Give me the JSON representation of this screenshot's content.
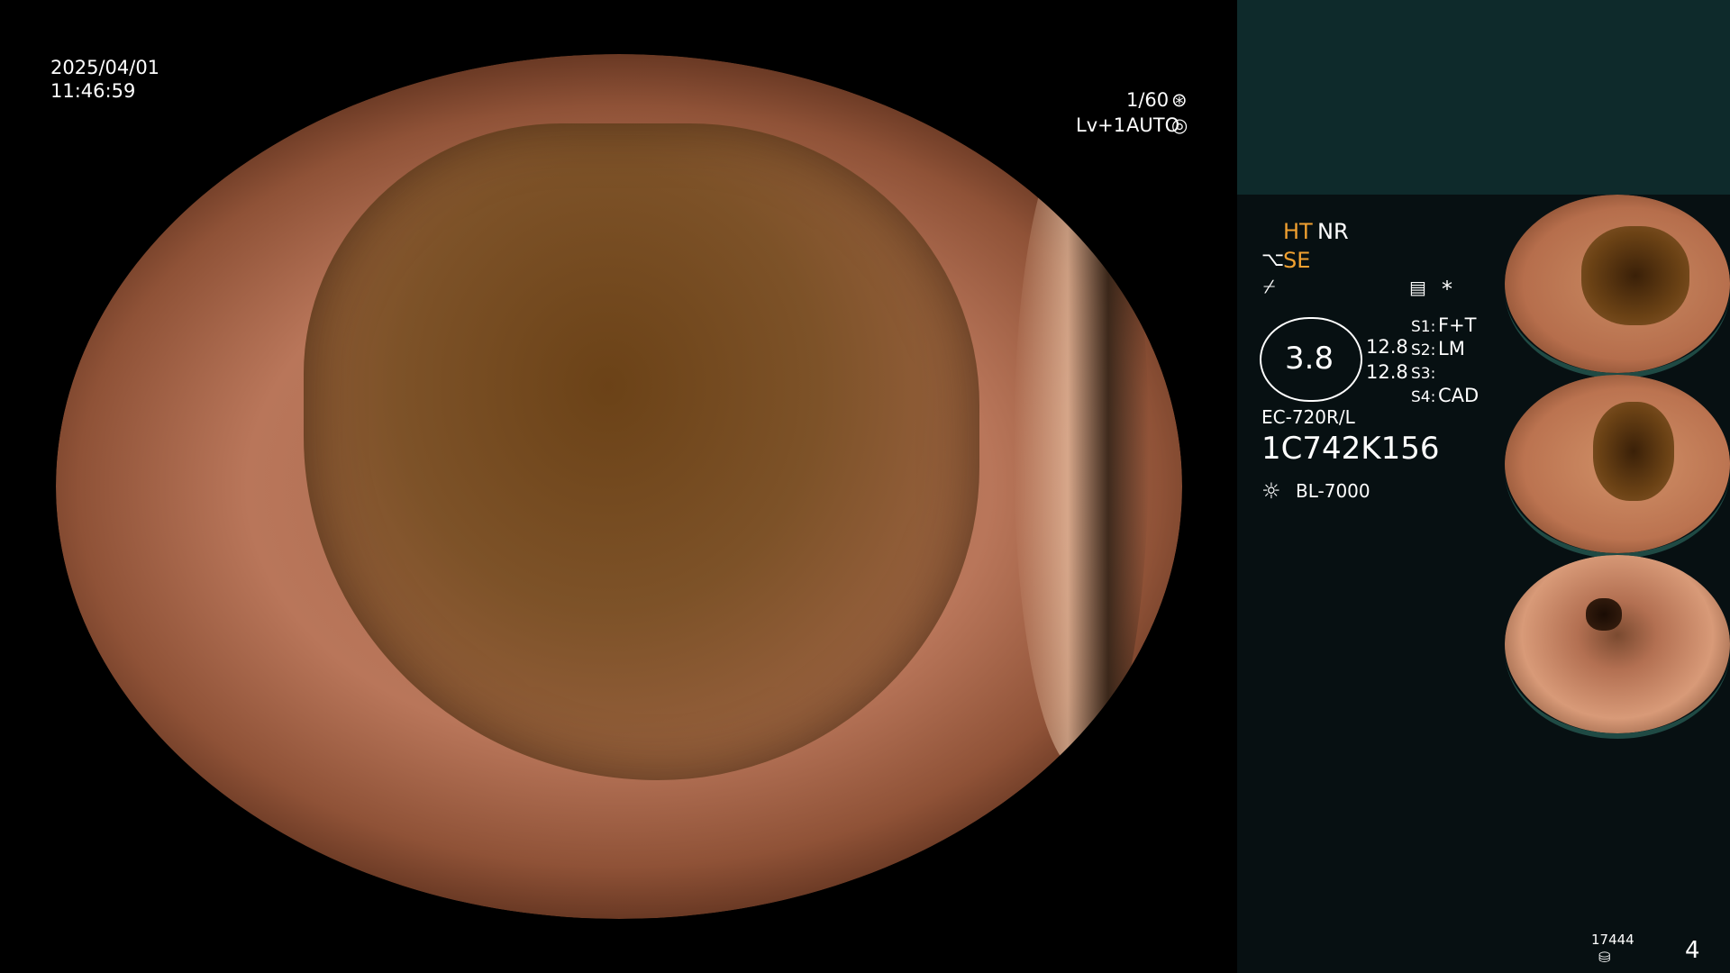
{
  "overlay": {
    "date": "2025/04/01",
    "time": "11:46:59",
    "shutter": "1/60",
    "level": "Lv+1",
    "iris": "AUTO"
  },
  "panel": {
    "ht": "HT",
    "nr": "NR",
    "se": "SE",
    "gauge_value": "3.8",
    "gauge_top": "12.8",
    "gauge_bottom": "12.8",
    "asterisk": "*",
    "s1_label": "S1:",
    "s1_value": "F+T",
    "s2_label": "S2:",
    "s2_value": "LM",
    "s3_label": "S3:",
    "s3_value": "",
    "s4_label": "S4:",
    "s4_value": "CAD",
    "scope_model": "EC-720R/L",
    "scope_serial": "1C742K156",
    "light_source": "BL-7000",
    "storage_count": "17444",
    "image_count": "4"
  },
  "thumbnails": [
    {
      "index": 1
    },
    {
      "index": 2
    },
    {
      "index": 3
    }
  ],
  "colors": {
    "accent": "#f0a030",
    "panel_bg": "#071012",
    "panel_top_bg": "#0e2a2b"
  }
}
